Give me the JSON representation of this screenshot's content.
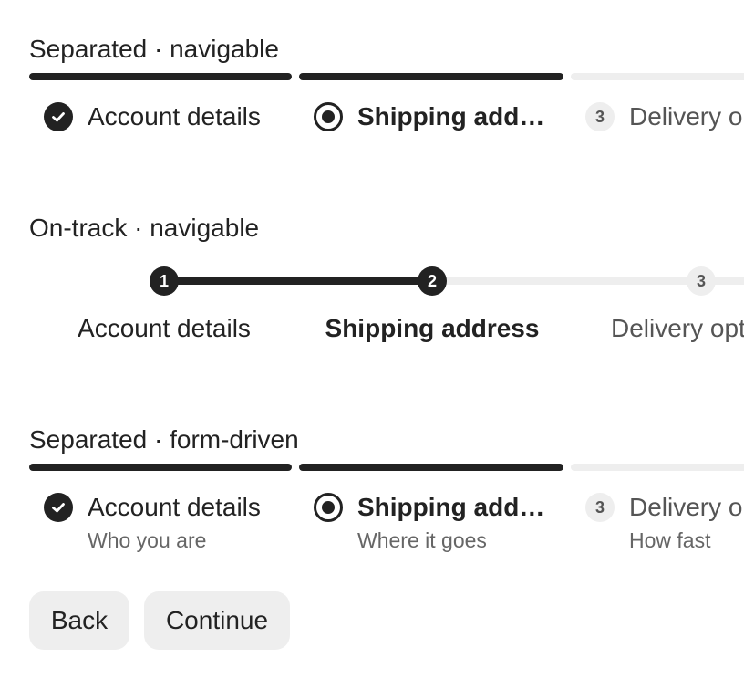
{
  "sections": {
    "separated_navigable": {
      "title": "Separated · navigable",
      "steps": [
        {
          "label": "Account details",
          "state": "complete",
          "icon": "check-icon"
        },
        {
          "label": "Shipping address",
          "state": "active",
          "icon": "radio-active-icon"
        },
        {
          "label": "Delivery options",
          "state": "upcoming",
          "number": "3"
        }
      ]
    },
    "ontrack_navigable": {
      "title": "On-track · navigable",
      "steps": [
        {
          "label": "Account details",
          "number": "1",
          "state": "complete"
        },
        {
          "label": "Shipping address",
          "number": "2",
          "state": "active"
        },
        {
          "label": "Delivery options",
          "number": "3",
          "state": "upcoming"
        }
      ]
    },
    "separated_form": {
      "title": "Separated · form-driven",
      "steps": [
        {
          "label": "Account details",
          "sub": "Who you are",
          "state": "complete",
          "icon": "check-icon"
        },
        {
          "label": "Shipping address",
          "sub": "Where it goes",
          "state": "active",
          "icon": "radio-active-icon"
        },
        {
          "label": "Delivery options",
          "sub": "How fast",
          "state": "upcoming",
          "number": "3"
        }
      ]
    }
  },
  "buttons": {
    "back": "Back",
    "continue": "Continue"
  },
  "colors": {
    "complete": "#222222",
    "upcoming": "#eeeeee",
    "muted_text": "#555555",
    "button_bg": "#eeeeee"
  }
}
